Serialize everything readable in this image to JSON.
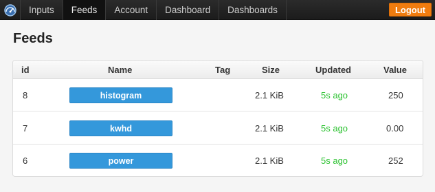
{
  "nav": {
    "items": [
      "Inputs",
      "Feeds",
      "Account",
      "Dashboard",
      "Dashboards"
    ],
    "active": "Feeds",
    "logout_label": "Logout",
    "brand_icon": "emoncms-gauge-icon"
  },
  "page": {
    "title": "Feeds"
  },
  "table": {
    "columns": {
      "id": "id",
      "name": "Name",
      "tag": "Tag",
      "size": "Size",
      "updated": "Updated",
      "value": "Value"
    },
    "rows": [
      {
        "id": "8",
        "name": "histogram",
        "tag": "",
        "size": "2.1 KiB",
        "updated": "5s ago",
        "value": "250"
      },
      {
        "id": "7",
        "name": "kwhd",
        "tag": "",
        "size": "2.1 KiB",
        "updated": "5s ago",
        "value": "0.00"
      },
      {
        "id": "6",
        "name": "power",
        "tag": "",
        "size": "2.1 KiB",
        "updated": "5s ago",
        "value": "252"
      }
    ]
  },
  "colors": {
    "navbar": "#1c1c1c",
    "logout": "#f07c0f",
    "name_button": "#3498db",
    "updated_text": "#29c12e"
  }
}
